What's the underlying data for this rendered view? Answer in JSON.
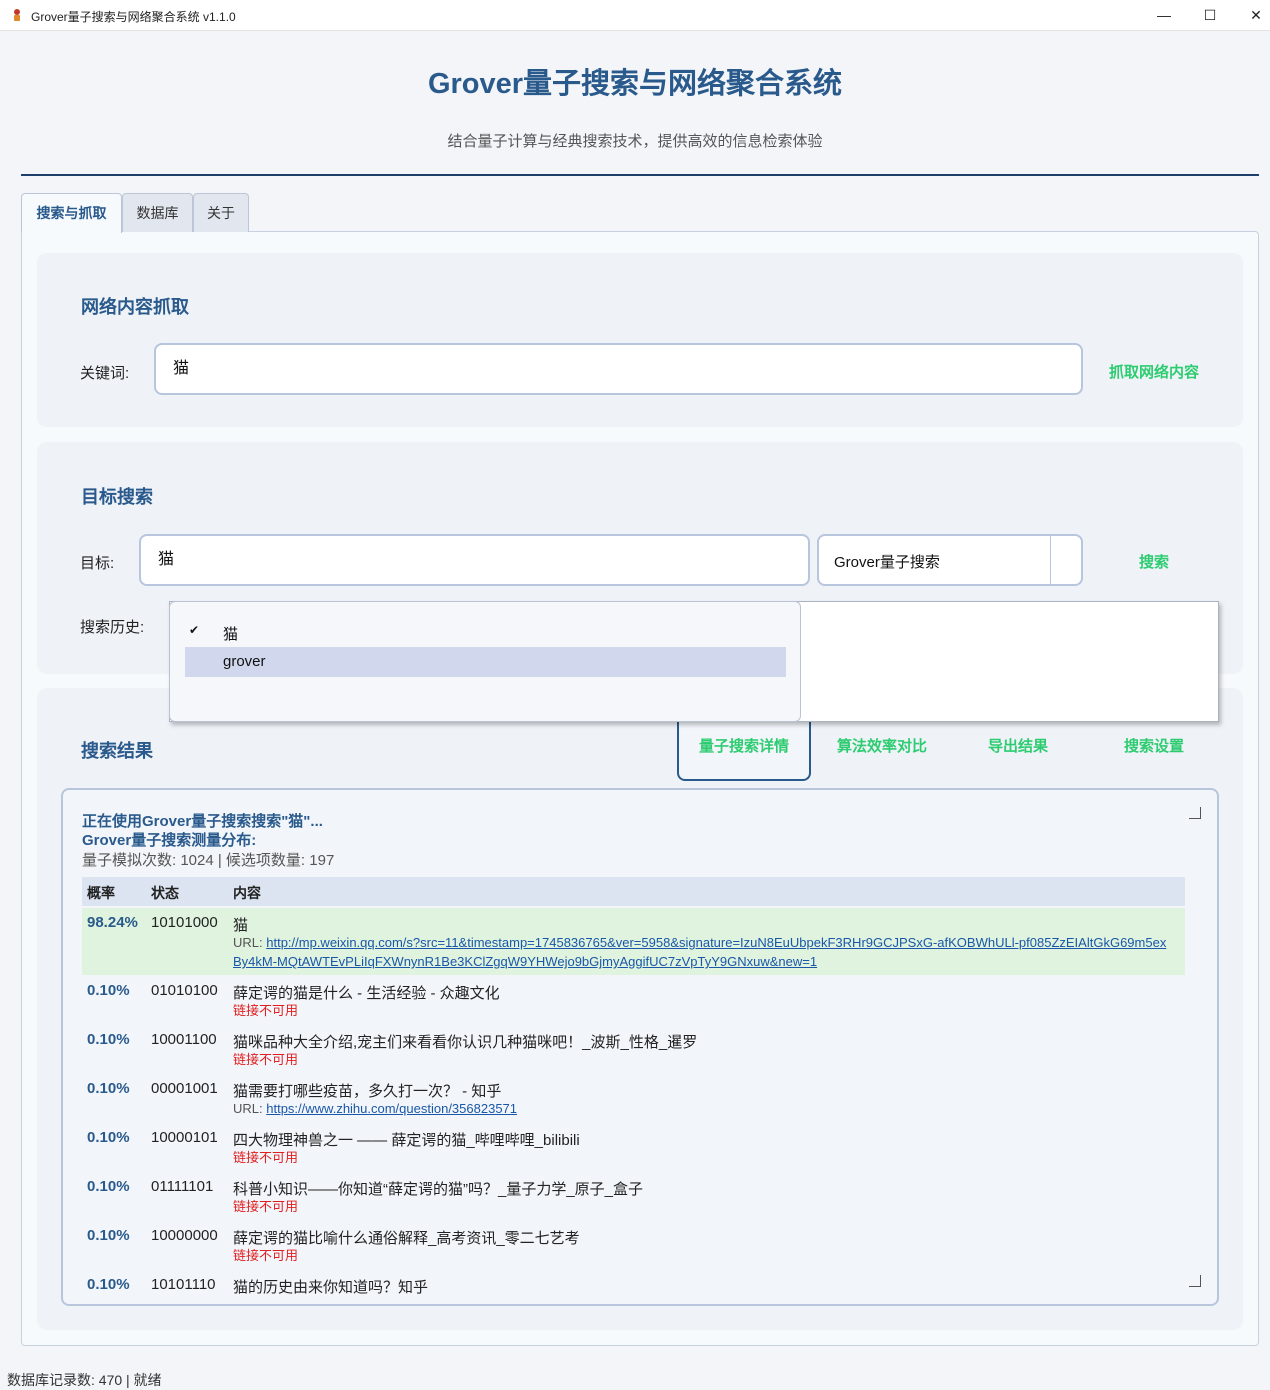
{
  "window": {
    "title": "Grover量子搜索与网络聚合系统 v1.1.0",
    "minimize": "—",
    "maximize": "☐",
    "close": "✕"
  },
  "header": {
    "title": "Grover量子搜索与网络聚合系统",
    "subtitle": "结合量子计算与经典搜索技术，提供高效的信息检索体验"
  },
  "tabs": [
    {
      "label": "搜索与抓取",
      "active": true
    },
    {
      "label": "数据库",
      "active": false
    },
    {
      "label": "关于",
      "active": false
    }
  ],
  "crawl": {
    "section_title": "网络内容抓取",
    "keyword_label": "关键词:",
    "keyword_value": "猫",
    "crawl_button": "抓取网络内容"
  },
  "target_search": {
    "section_title": "目标搜索",
    "target_label": "目标:",
    "target_value": "猫",
    "algorithm_selected": "Grover量子搜索",
    "search_button": "搜索",
    "history_label": "搜索历史:",
    "history_items": [
      {
        "label": "猫",
        "checked": true,
        "check_mark": "✔"
      },
      {
        "label": "grover",
        "checked": false,
        "check_mark": ""
      }
    ]
  },
  "results": {
    "section_title": "搜索结果",
    "tabs": [
      {
        "label": "量子搜索详情",
        "active": true
      },
      {
        "label": "算法效率对比",
        "active": false
      },
      {
        "label": "导出结果",
        "active": false
      },
      {
        "label": "搜索设置",
        "active": false
      }
    ],
    "header_line1": "正在使用Grover量子搜索搜索\"猫\"...",
    "header_line2": "Grover量子搜索测量分布:",
    "stats": "量子模拟次数: 1024 | 候选项数量: 197",
    "columns": {
      "prob": "概率",
      "state": "状态",
      "content": "内容"
    },
    "url_prefix": "URL: ",
    "unavailable_text": "链接不可用",
    "rows": [
      {
        "prob": "98.24%",
        "state": "10101000",
        "content": "猫",
        "url": "http://mp.weixin.qq.com/s?src=11&timestamp=1745836765&ver=5958&signature=IzuN8EuUbpekF3RHr9GCJPSxG-afKOBWhULl-pf085ZzEIAltGkG69m5exBy4kM-MQtAWTEvPLiIqFXWnynR1Be3KClZgqW9YHWejo9bGjmyAggifUC7zVpTyY9GNxuw&new=1",
        "highlight": true
      },
      {
        "prob": "0.10%",
        "state": "01010100",
        "content": "薛定谔的猫是什么 - 生活经验 - 众趣文化",
        "url": null
      },
      {
        "prob": "0.10%",
        "state": "10001100",
        "content": "猫咪品种大全介绍,宠主们来看看你认识几种猫咪吧！_波斯_性格_暹罗",
        "url": null
      },
      {
        "prob": "0.10%",
        "state": "00001001",
        "content": "猫需要打哪些疫苗，多久打一次？ - 知乎",
        "url": "https://www.zhihu.com/question/356823571"
      },
      {
        "prob": "0.10%",
        "state": "10000101",
        "content": "四大物理神兽之一 —— 薛定谔的猫_哔哩哔哩_bilibili",
        "url": null
      },
      {
        "prob": "0.10%",
        "state": "01111101",
        "content": "科普小知识——你知道“薛定谔的猫”吗？_量子力学_原子_盒子",
        "url": null
      },
      {
        "prob": "0.10%",
        "state": "10000000",
        "content": "薛定谔的猫比喻什么通俗解释_高考资讯_零二七艺考",
        "url": null
      },
      {
        "prob": "0.10%",
        "state": "10101110",
        "content": "猫的历史由来你知道吗？知乎",
        "url": null
      }
    ]
  },
  "status": "数据库记录数: 470 | 就绪"
}
